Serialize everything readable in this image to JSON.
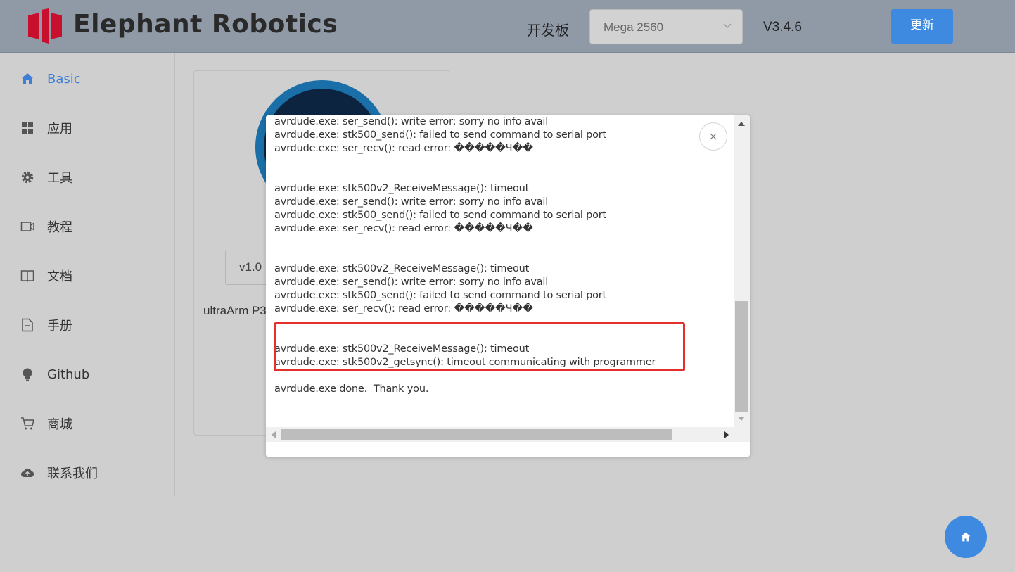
{
  "header": {
    "brand": "Elephant Robotics",
    "board_label": "开发板",
    "board_value": "Mega 2560",
    "version": "V3.4.6",
    "update_label": "更新"
  },
  "sidebar": {
    "items": [
      {
        "label": "Basic",
        "icon": "home-icon",
        "active": true
      },
      {
        "label": "应用",
        "icon": "grid-icon"
      },
      {
        "label": "工具",
        "icon": "gear-icon"
      },
      {
        "label": "教程",
        "icon": "video-icon"
      },
      {
        "label": "文档",
        "icon": "book-icon"
      },
      {
        "label": "手册",
        "icon": "file-icon"
      },
      {
        "label": "Github",
        "icon": "bulb-icon"
      },
      {
        "label": "商城",
        "icon": "cart-icon"
      },
      {
        "label": "联系我们",
        "icon": "cloud-icon"
      }
    ]
  },
  "card": {
    "version": "v1.0",
    "name": "ultraArm P3"
  },
  "log": {
    "lines": [
      "avrdude.exe: ser_send(): write error: sorry no info avail",
      "avrdude.exe: stk500_send(): failed to send command to serial port",
      "avrdude.exe: ser_recv(): read error: �����Ч��",
      "",
      "",
      "avrdude.exe: stk500v2_ReceiveMessage(): timeout",
      "avrdude.exe: ser_send(): write error: sorry no info avail",
      "avrdude.exe: stk500_send(): failed to send command to serial port",
      "avrdude.exe: ser_recv(): read error: �����Ч��",
      "",
      "",
      "avrdude.exe: stk500v2_ReceiveMessage(): timeout",
      "avrdude.exe: ser_send(): write error: sorry no info avail",
      "avrdude.exe: stk500_send(): failed to send command to serial port",
      "avrdude.exe: ser_recv(): read error: �����Ч��",
      "",
      "",
      "avrdude.exe: stk500v2_ReceiveMessage(): timeout",
      "avrdude.exe: stk500v2_getsync(): timeout communicating with programmer",
      "",
      "avrdude.exe done.  Thank you."
    ]
  },
  "colors": {
    "header_bg": "#8f9aa6",
    "accent": "#3d8ae0",
    "highlight_border": "#e3302a"
  }
}
